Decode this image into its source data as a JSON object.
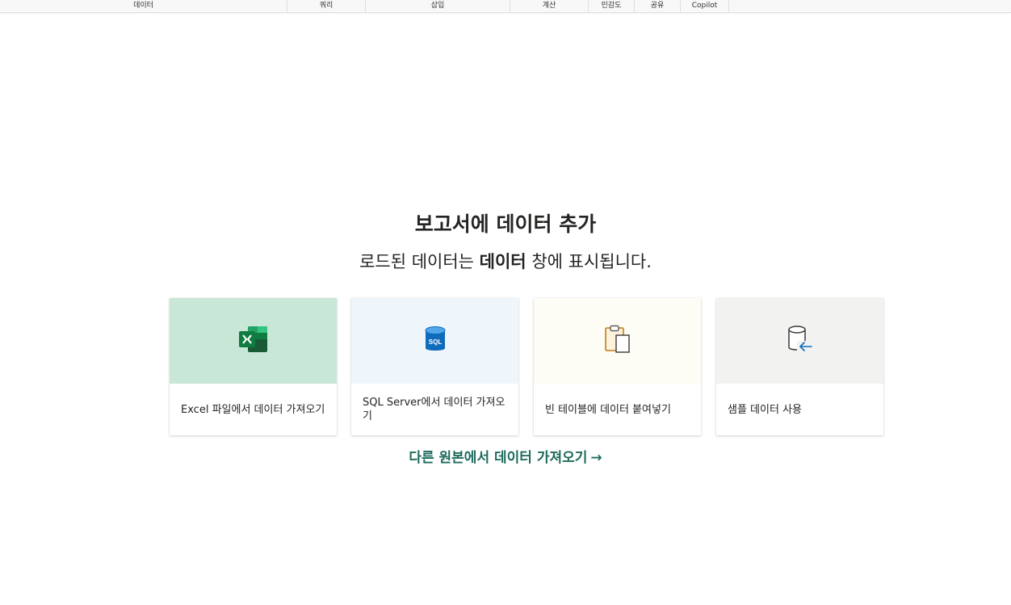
{
  "ribbon": {
    "groups": {
      "data": "데이터",
      "query": "쿼리",
      "insert": "삽입",
      "calculation": "계산",
      "sensitivity": "민감도",
      "share": "공유",
      "copilot": "Copilot"
    }
  },
  "main": {
    "title": "보고서에 데이터 추가",
    "subtitle_prefix": "로드된 데이터는",
    "subtitle_bold": "데이터",
    "subtitle_suffix": "창에 표시됩니다.",
    "cards": [
      {
        "label": "Excel 파일에서 데이터 가져오기",
        "icon": "excel-icon",
        "color": "#c9e7d6"
      },
      {
        "label": "SQL Server에서 데이터 가져오기",
        "icon": "sql-server-icon",
        "color": "#eef5fb"
      },
      {
        "label": "빈 테이블에 데이터 붙여넣기",
        "icon": "clipboard-icon",
        "color": "#fdfcf5"
      },
      {
        "label": "샘플 데이터 사용",
        "icon": "sample-database-icon",
        "color": "#f2f2f1"
      }
    ],
    "other_sources_link": "다른 원본에서 데이터 가져오기",
    "other_sources_arrow": "→"
  },
  "accent_color": "#1e6b5c"
}
